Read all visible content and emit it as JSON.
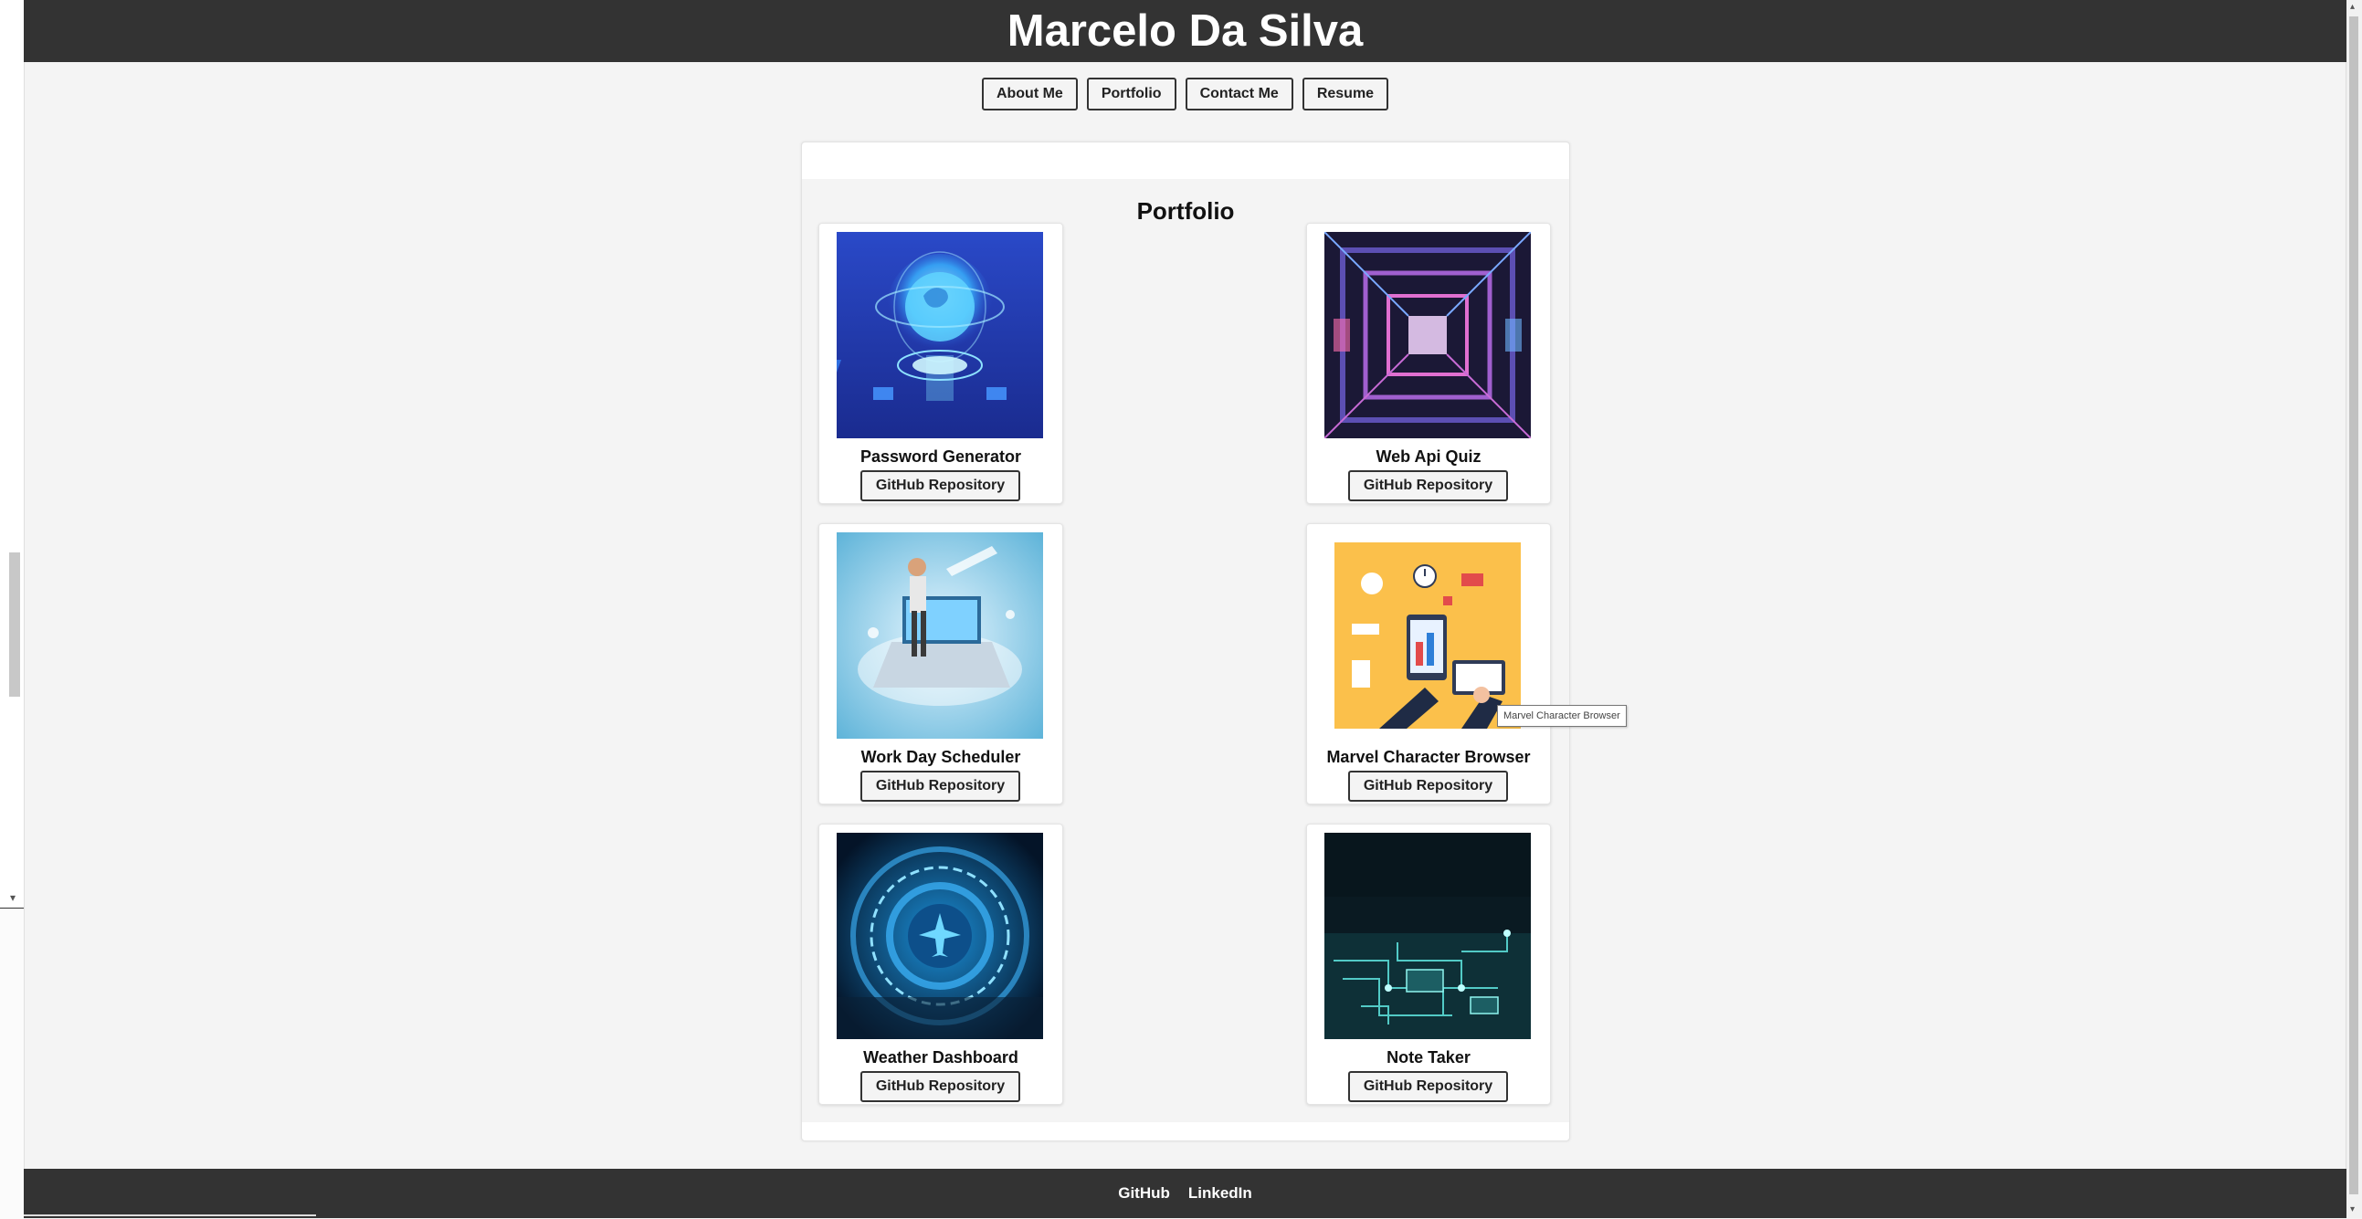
{
  "site": {
    "title": "Marcelo Da Silva"
  },
  "nav": {
    "items": [
      {
        "label": "About Me"
      },
      {
        "label": "Portfolio"
      },
      {
        "label": "Contact Me"
      },
      {
        "label": "Resume"
      }
    ]
  },
  "portfolio": {
    "heading": "Portfolio",
    "projects": [
      {
        "title": "Password Generator",
        "button": "GitHub Repository",
        "image": "globe-hologram-image"
      },
      {
        "title": "Web Api Quiz",
        "button": "GitHub Repository",
        "image": "neon-circuit-tunnel-image"
      },
      {
        "title": "Work Day Scheduler",
        "button": "GitHub Repository",
        "image": "businessman-laptop-image"
      },
      {
        "title": "Marvel Character Browser",
        "button": "GitHub Repository",
        "image": "analytics-dashboard-illustration"
      },
      {
        "title": "Weather Dashboard",
        "button": "GitHub Repository",
        "image": "airplane-tech-dial-image"
      },
      {
        "title": "Note Taker",
        "button": "GitHub Repository",
        "image": "circuit-board-image"
      }
    ]
  },
  "tooltip": {
    "text": "Marvel Character Browser"
  },
  "footer": {
    "links": [
      {
        "label": "GitHub"
      },
      {
        "label": "LinkedIn"
      }
    ]
  },
  "colors": {
    "header_bg": "#333333",
    "page_bg": "#f4f4f4",
    "card_bg": "#ffffff"
  }
}
